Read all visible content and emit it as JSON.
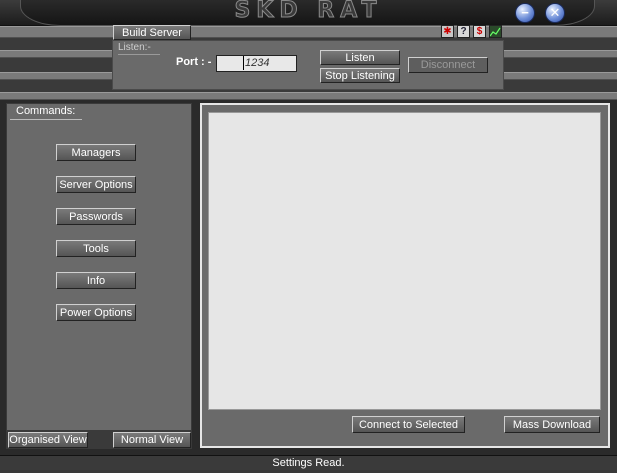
{
  "app": {
    "title": "SKD RAT"
  },
  "toolbar": {
    "build_server": "Build Server",
    "icons": [
      "bug-icon",
      "help-icon",
      "dollar-icon",
      "graph-icon"
    ],
    "help_glyph": "?",
    "dollar_glyph": "$"
  },
  "listen": {
    "section_label": "Listen:-",
    "port_label": "Port : -",
    "port_value": "1234",
    "listen_button": "Listen",
    "stop_button": "Stop Listening",
    "disconnect_button": "Disconnect"
  },
  "commands": {
    "section_label": "Commands:",
    "items": [
      {
        "label": "Managers"
      },
      {
        "label": "Server Options"
      },
      {
        "label": "Passwords"
      },
      {
        "label": "Tools"
      },
      {
        "label": "Info"
      },
      {
        "label": "Power Options"
      }
    ]
  },
  "views": {
    "organised": "Organised View",
    "normal": "Normal View"
  },
  "main": {
    "connect_button": "Connect to Selected",
    "mass_download_button": "Mass Download"
  },
  "status": {
    "text": "Settings Read."
  },
  "colors": {
    "panel": "#6a6a6a",
    "background": "#2a2a2a",
    "list_bg": "#e6e6e6",
    "title_button": "#6f8fd8"
  }
}
